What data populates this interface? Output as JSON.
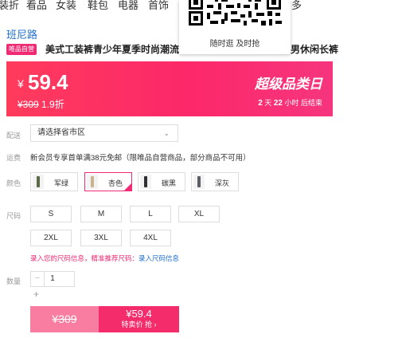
{
  "topnav": [
    "装折",
    "看品",
    "女装",
    "鞋包",
    "电器",
    "首饰",
    "多"
  ],
  "qr_popup": {
    "caption": "随时逛 及时抢"
  },
  "product": {
    "brand": "班尼路",
    "badge": "唯品自营",
    "title_visible": "美式工装裤青少年夏季时尚潮流",
    "title_tail": "男休闲长裤"
  },
  "price_banner": {
    "currency": "¥",
    "price": "59.4",
    "orig_price": "¥309",
    "discount": "1.9折",
    "promo_title": "超级品类日",
    "countdown": {
      "days": "2",
      "days_unit": "天",
      "hours": "22",
      "hours_unit": "小时",
      "suffix": "后结束"
    }
  },
  "delivery": {
    "label": "配送",
    "placeholder": "请选择省市区"
  },
  "shipping": {
    "label": "运费",
    "text": "新会员专享首单满38元免邮（限唯品自营商品，部分商品不可用）"
  },
  "colors": {
    "label": "颜色",
    "options": [
      {
        "name": "军绿",
        "swatch": "#5d6a48",
        "selected": false
      },
      {
        "name": "杏色",
        "swatch": "#c9b48f",
        "selected": true
      },
      {
        "name": "碳黑",
        "swatch": "#2e2e33",
        "selected": false
      },
      {
        "name": "深灰",
        "swatch": "#5b5e66",
        "selected": false
      }
    ]
  },
  "sizes": {
    "label": "尺码",
    "options": [
      "S",
      "M",
      "L",
      "XL",
      "2XL",
      "3XL",
      "4XL"
    ]
  },
  "size_hint": {
    "text": "录入您的尺码信息，精准推荐尺码：",
    "link": "录入尺码信息"
  },
  "quantity": {
    "label": "数量",
    "value": "1",
    "minus": "−",
    "plus": "+"
  },
  "actions": {
    "orig_price": "¥309",
    "buy_price": "¥59.4",
    "buy_label": "特卖价 抢 ›"
  },
  "colors_theme": {
    "accent": "#f02a74",
    "link": "#1f6fd0"
  }
}
